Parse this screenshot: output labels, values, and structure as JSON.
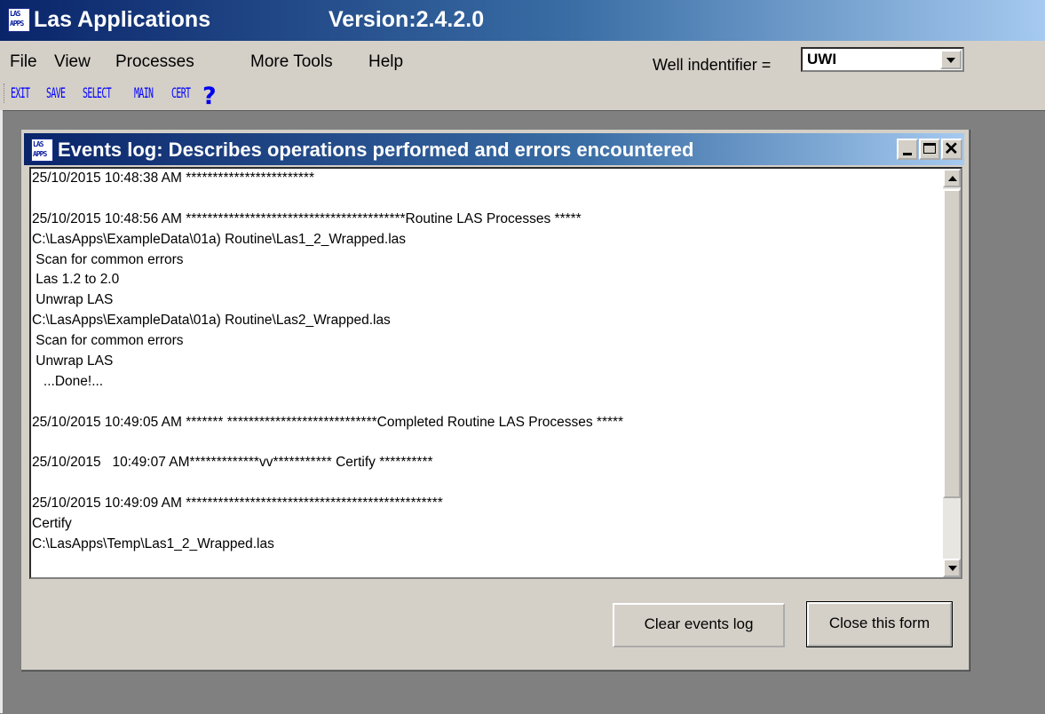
{
  "app": {
    "title": "Las Applications",
    "version": "Version:2.4.2.0",
    "logo_top": "LAS",
    "logo_bottom": "APPS"
  },
  "menu": [
    "File",
    "View",
    "Processes",
    "More Tools",
    "Help"
  ],
  "well": {
    "label": "Well indentifier =",
    "value": "UWI"
  },
  "toolbar": {
    "buttons": [
      "EXIT",
      "SAVE",
      "SELECT",
      "MAIN",
      "CERT"
    ],
    "help_icon": "question-mark-icon"
  },
  "events_window": {
    "title": "Events log: Describes operations performed and errors encountered",
    "log_lines": [
      "25/10/2015 10:48:38 AM ************************",
      "",
      "25/10/2015 10:48:56 AM *****************************************Routine LAS Processes *****",
      "C:\\LasApps\\ExampleData\\01a) Routine\\Las1_2_Wrapped.las",
      " Scan for common errors",
      " Las 1.2 to 2.0",
      " Unwrap LAS",
      "C:\\LasApps\\ExampleData\\01a) Routine\\Las2_Wrapped.las",
      " Scan for common errors",
      " Unwrap LAS",
      "   ...Done!...",
      "",
      "25/10/2015 10:49:05 AM ******* ****************************Completed Routine LAS Processes *****",
      "",
      "25/10/2015   10:49:07 AM*************vv*********** Certify **********",
      "",
      "25/10/2015 10:49:09 AM ************************************************",
      "Certify",
      "C:\\LasApps\\Temp\\Las1_2_Wrapped.las"
    ],
    "clear_button": "Clear events log",
    "close_button": "Close this form"
  },
  "colors": {
    "titlebar_start": "#0a246a",
    "titlebar_end": "#a6caf0",
    "face": "#d4d0c8",
    "mdi_background": "#808080",
    "toolbar_text": "#0000ff"
  }
}
